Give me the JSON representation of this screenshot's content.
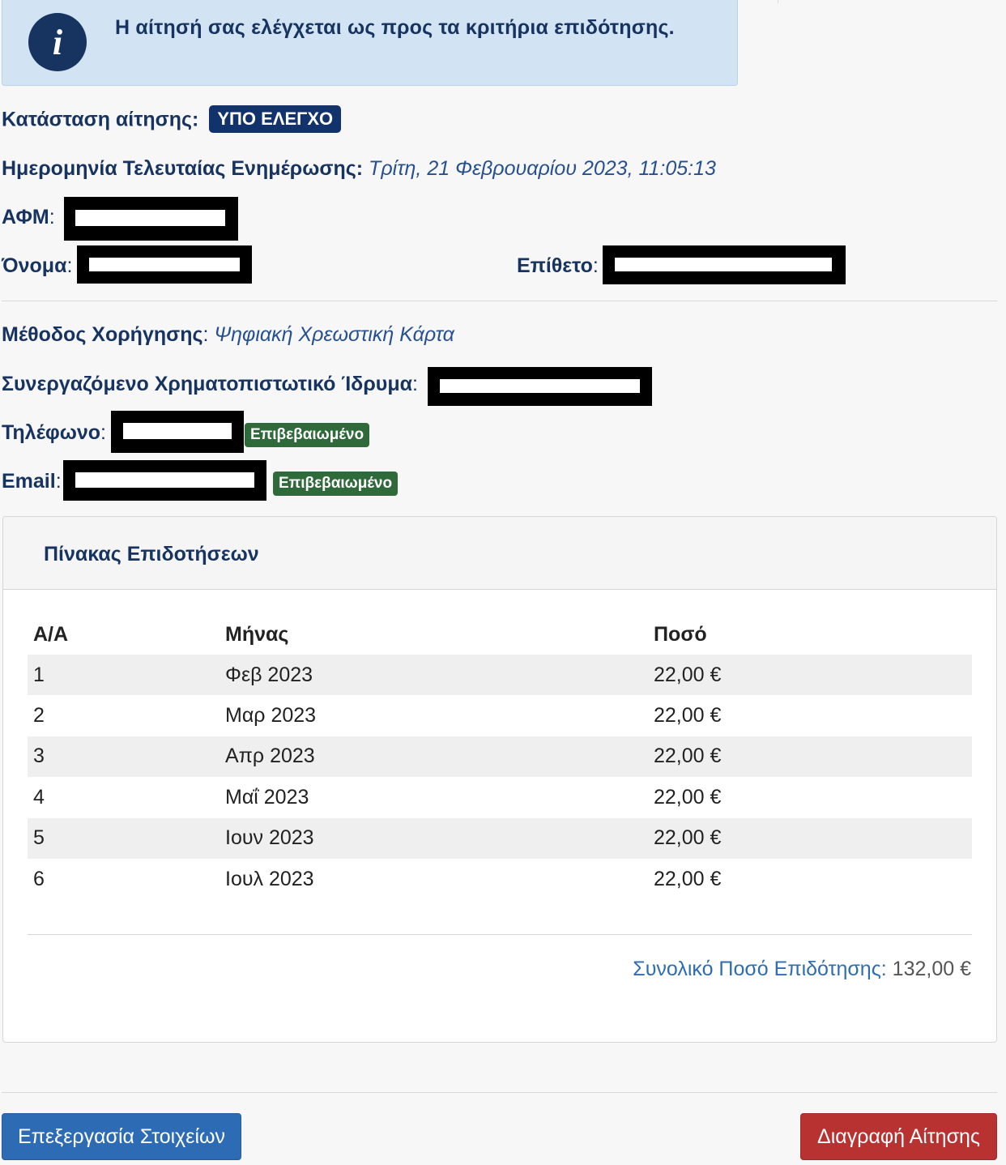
{
  "alert": {
    "icon": "info-icon",
    "icon_glyph": "i",
    "message": "Η αίτησή σας ελέγχεται ως προς τα κριτήρια επιδότησης."
  },
  "status": {
    "label": "Κατάσταση αίτησης:",
    "badge": "ΥΠΟ ΕΛΕΓΧΟ",
    "badge_color": "#12326b"
  },
  "last_update": {
    "label": "Ημερομηνία Τελευταίας Ενημέρωσης:",
    "value": "Τρίτη, 21 Φεβρουαρίου 2023, 11:05:13"
  },
  "personal": {
    "afm_label": "ΑΦΜ",
    "first_name_label": "Όνομα",
    "last_name_label": "Επίθετο"
  },
  "payment": {
    "method_label": "Μέθοδος Χορήγησης",
    "method_value": "Ψηφιακή Χρεωστική Κάρτα",
    "bank_label": "Συνεργαζόμενο Χρηματοπιστωτικό Ίδρυμα",
    "phone_label": "Τηλέφωνο",
    "phone_status": "Επιβεβαιωμένο",
    "email_label": "Email",
    "email_status": "Επιβεβαιωμένο",
    "verified_color": "#2f6b3a"
  },
  "subsidies": {
    "title": "Πίνακας Επιδοτήσεων",
    "columns": [
      "Α/Α",
      "Μήνας",
      "Ποσό"
    ],
    "rows": [
      [
        "1",
        "Φεβ 2023",
        "22,00 €"
      ],
      [
        "2",
        "Μαρ 2023",
        "22,00 €"
      ],
      [
        "3",
        "Απρ 2023",
        "22,00 €"
      ],
      [
        "4",
        "Μαΐ 2023",
        "22,00 €"
      ],
      [
        "5",
        "Ιουν 2023",
        "22,00 €"
      ],
      [
        "6",
        "Ιουλ 2023",
        "22,00 €"
      ]
    ],
    "total_label": "Συνολικό Ποσό Επιδότησης:",
    "total_value": "132,00 €"
  },
  "actions": {
    "edit_label": "Επεξεργασία Στοιχείων",
    "delete_label": "Διαγραφή Αίτησης",
    "edit_color": "#2d6cb5",
    "delete_color": "#b73231"
  }
}
